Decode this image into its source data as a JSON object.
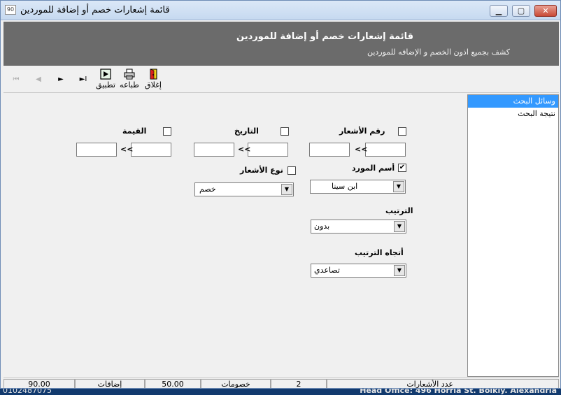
{
  "window": {
    "title": "قائمة إشعارات خصم أو إضافة للموردين",
    "icon": "app-icon",
    "minimize": "▁",
    "maximize": "▢",
    "close": "✕"
  },
  "header": {
    "title": "قائمة إشعارات خصم أو إضافة للموردين",
    "subtitle": "كشف بجميع اذون الخصم و الإضافه للموردين"
  },
  "toolbar": {
    "first": "⏮",
    "prev": "◀",
    "next": "►",
    "last": "►I",
    "apply_label": "تطبيق",
    "print_label": "طباعه",
    "close_label": "إغلاق"
  },
  "side_list": {
    "items": [
      {
        "label": "وسائل البحث",
        "selected": true
      },
      {
        "label": "نتيجة البحث",
        "selected": false
      }
    ]
  },
  "filters": {
    "notice_no": {
      "label": "رقم الأشعار",
      "checked": false,
      "from": "",
      "to": ""
    },
    "date": {
      "label": "التاريخ",
      "checked": false,
      "from": "",
      "to": ""
    },
    "value": {
      "label": "القيمة",
      "checked": false,
      "from": "",
      "to": ""
    },
    "range_sep": "<<",
    "supplier": {
      "label": "أسم المورد",
      "checked": true,
      "value": "ابن سينا"
    },
    "notice_type": {
      "label": "نوع الأشعار",
      "checked": false,
      "value": "خصم"
    },
    "sort": {
      "label": "الترتيب",
      "value": "بدون"
    },
    "sort_dir": {
      "label": "أتجاه الترتيب",
      "value": "تصاعدي"
    }
  },
  "status": {
    "count_label": "عدد الأشعارات",
    "count_value": "2",
    "discounts_label": "خصومات",
    "discounts_value": "50.00",
    "additions_label": "إضافات",
    "additions_value": "90.00"
  },
  "background": {
    "left_text": "0102487075",
    "right_text": "Head Office: 496 Horria St. Bolkly. Alexandria"
  }
}
